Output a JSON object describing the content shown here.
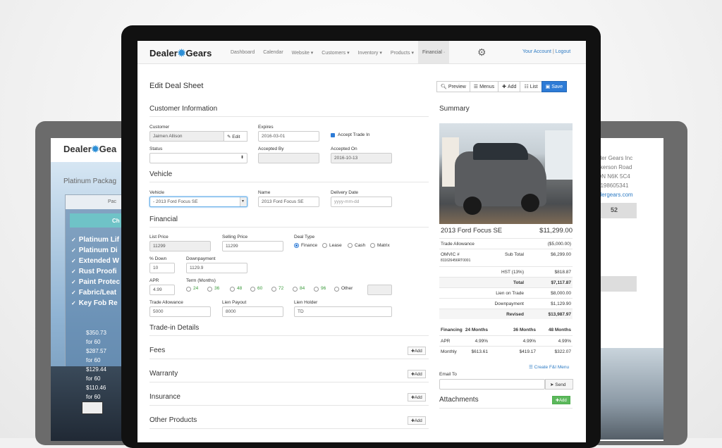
{
  "bg_left": {
    "brand": "Dealer",
    "brand_tail": "Gea",
    "package_title": "Platinum Packag",
    "panel_header": "Pac",
    "teal_button": "Ch",
    "features": [
      "Platinum Lif",
      "Platinum Di",
      "Extended W",
      "Rust Proofi",
      "Paint Protec",
      "Fabric/Leat",
      "Key Fob Re"
    ],
    "prices": [
      "$350.73",
      "for 60",
      "$287.57",
      "for 60",
      "$129.44",
      "for 60",
      "$110.46",
      "for 60"
    ]
  },
  "bg_right": {
    "address": [
      "aler Gears Inc",
      "ckerson Road",
      "ON N6K 5C4",
      "5198605341",
      "alergears.com"
    ],
    "box_value": "52"
  },
  "nav": {
    "brand_left": "Dealer",
    "brand_right": "Gears",
    "items": [
      "Dashboard",
      "Calendar",
      "Website ▾",
      "Customers ▾",
      "Inventory ▾",
      "Products ▾",
      "Financial ·"
    ],
    "account": "Your Account",
    "separator": "|",
    "logout": "Logout"
  },
  "page": {
    "title": "Edit Deal Sheet",
    "toolbar": {
      "preview": "Preview",
      "menus": "Menus",
      "add": "Add",
      "list": "List",
      "save": "Save"
    }
  },
  "customer": {
    "section": "Customer Information",
    "customer_label": "Customer",
    "customer_value": "Jaimen Allison",
    "edit_label": "Edit",
    "expires_label": "Expires",
    "expires_value": "2016-03-01",
    "accept_trade": "Accept Trade In",
    "status_label": "Status",
    "status_value": "",
    "accepted_by_label": "Accepted By",
    "accepted_by_value": "",
    "accepted_on_label": "Accepted On",
    "accepted_on_value": "2016-10-13"
  },
  "vehicle": {
    "section": "Vehicle",
    "vehicle_label": "Vehicle",
    "vehicle_value": "- 2013 Ford Focus SE",
    "name_label": "Name",
    "name_value": "2013 Ford Focus SE",
    "delivery_label": "Delivery Date",
    "delivery_placeholder": "yyyy-mm-dd"
  },
  "financial": {
    "section": "Financial",
    "list_price_label": "List Price",
    "list_price_value": "11299",
    "selling_price_label": "Selling Price",
    "selling_price_value": "11299",
    "deal_type_label": "Deal Type",
    "deal_types": [
      "Finance",
      "Lease",
      "Cash",
      "Matrix"
    ],
    "pct_down_label": "% Down",
    "pct_down_value": "10",
    "downpayment_label": "Downpayment",
    "downpayment_value": "1129.9",
    "apr_label": "APR",
    "apr_value": "4.99",
    "term_label": "Term (Months)",
    "terms": [
      "24",
      "36",
      "48",
      "60",
      "72",
      "84",
      "96",
      "Other"
    ],
    "trade_allowance_label": "Trade Allowance",
    "trade_allowance_value": "5000",
    "lien_payout_label": "Lien Payout",
    "lien_payout_value": "8000",
    "lien_holder_label": "Lien Holder",
    "lien_holder_value": "TD"
  },
  "sections": {
    "trade_in": "Trade-in Details",
    "fees": "Fees",
    "warranty": "Warranty",
    "insurance": "Insurance",
    "other_products": "Other Products",
    "add_label": "Add"
  },
  "summary": {
    "title": "Summary",
    "vehicle_name": "2013 Ford Focus SE",
    "vehicle_price": "$11,299.00",
    "rows": {
      "trade_allowance_label": "Trade Allowance",
      "trade_allowance_value": "($5,000.00)",
      "omvic_label": "OMVIC #",
      "omvic_number": "811626456RT0001",
      "subtotal_label": "Sub Total",
      "subtotal_value": "$6,299.00",
      "hst_label": "HST (13%)",
      "hst_value": "$818.87",
      "total_label": "Total",
      "total_value": "$7,117.87",
      "lien_label": "Lien on Trade",
      "lien_value": "$8,000.00",
      "down_label": "Downpayment",
      "down_value": "$1,129.90",
      "revised_label": "Revised",
      "revised_value": "$13,987.97"
    },
    "financing": {
      "headers": [
        "Financing",
        "24 Months",
        "36 Months",
        "48 Months"
      ],
      "apr": [
        "APR",
        "4.99%",
        "4.99%",
        "4.99%"
      ],
      "monthly": [
        "Monthly",
        "$613.61",
        "$419.17",
        "$322.07"
      ]
    },
    "fi_menu_link": "Create F&I Menu",
    "email_label": "Email To",
    "send_label": "Send",
    "attachments": "Attachments",
    "attach_add": "Add"
  }
}
